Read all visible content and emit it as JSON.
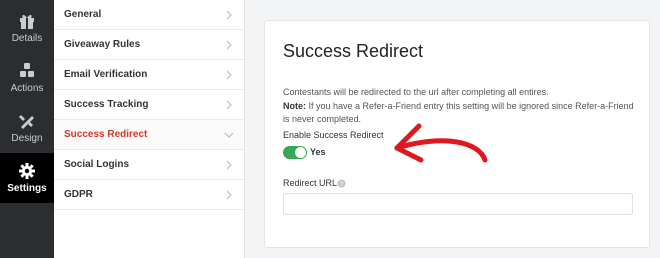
{
  "rail": {
    "details": "Details",
    "actions": "Actions",
    "design": "Design",
    "settings": "Settings"
  },
  "menu": [
    {
      "label": "General"
    },
    {
      "label": "Giveaway Rules"
    },
    {
      "label": "Email Verification"
    },
    {
      "label": "Success Tracking"
    },
    {
      "label": "Success Redirect",
      "active": true
    },
    {
      "label": "Social Logins"
    },
    {
      "label": "GDPR"
    }
  ],
  "panel": {
    "title": "Success Redirect",
    "description": "Contestants will be redirected to the url after completing all entires.",
    "note_label": "Note:",
    "note_text": "If you have a Refer-a-Friend entry this setting will be ignored since Refer-a-Friend is never completed.",
    "toggle_label": "Enable Success Redirect",
    "toggle_value": "Yes",
    "toggle_on": true,
    "url_label": "Redirect URL",
    "url_value": ""
  },
  "colors": {
    "accent_active": "#d9342b",
    "toggle_on": "#3aa757",
    "arrow": "#e0171f"
  }
}
